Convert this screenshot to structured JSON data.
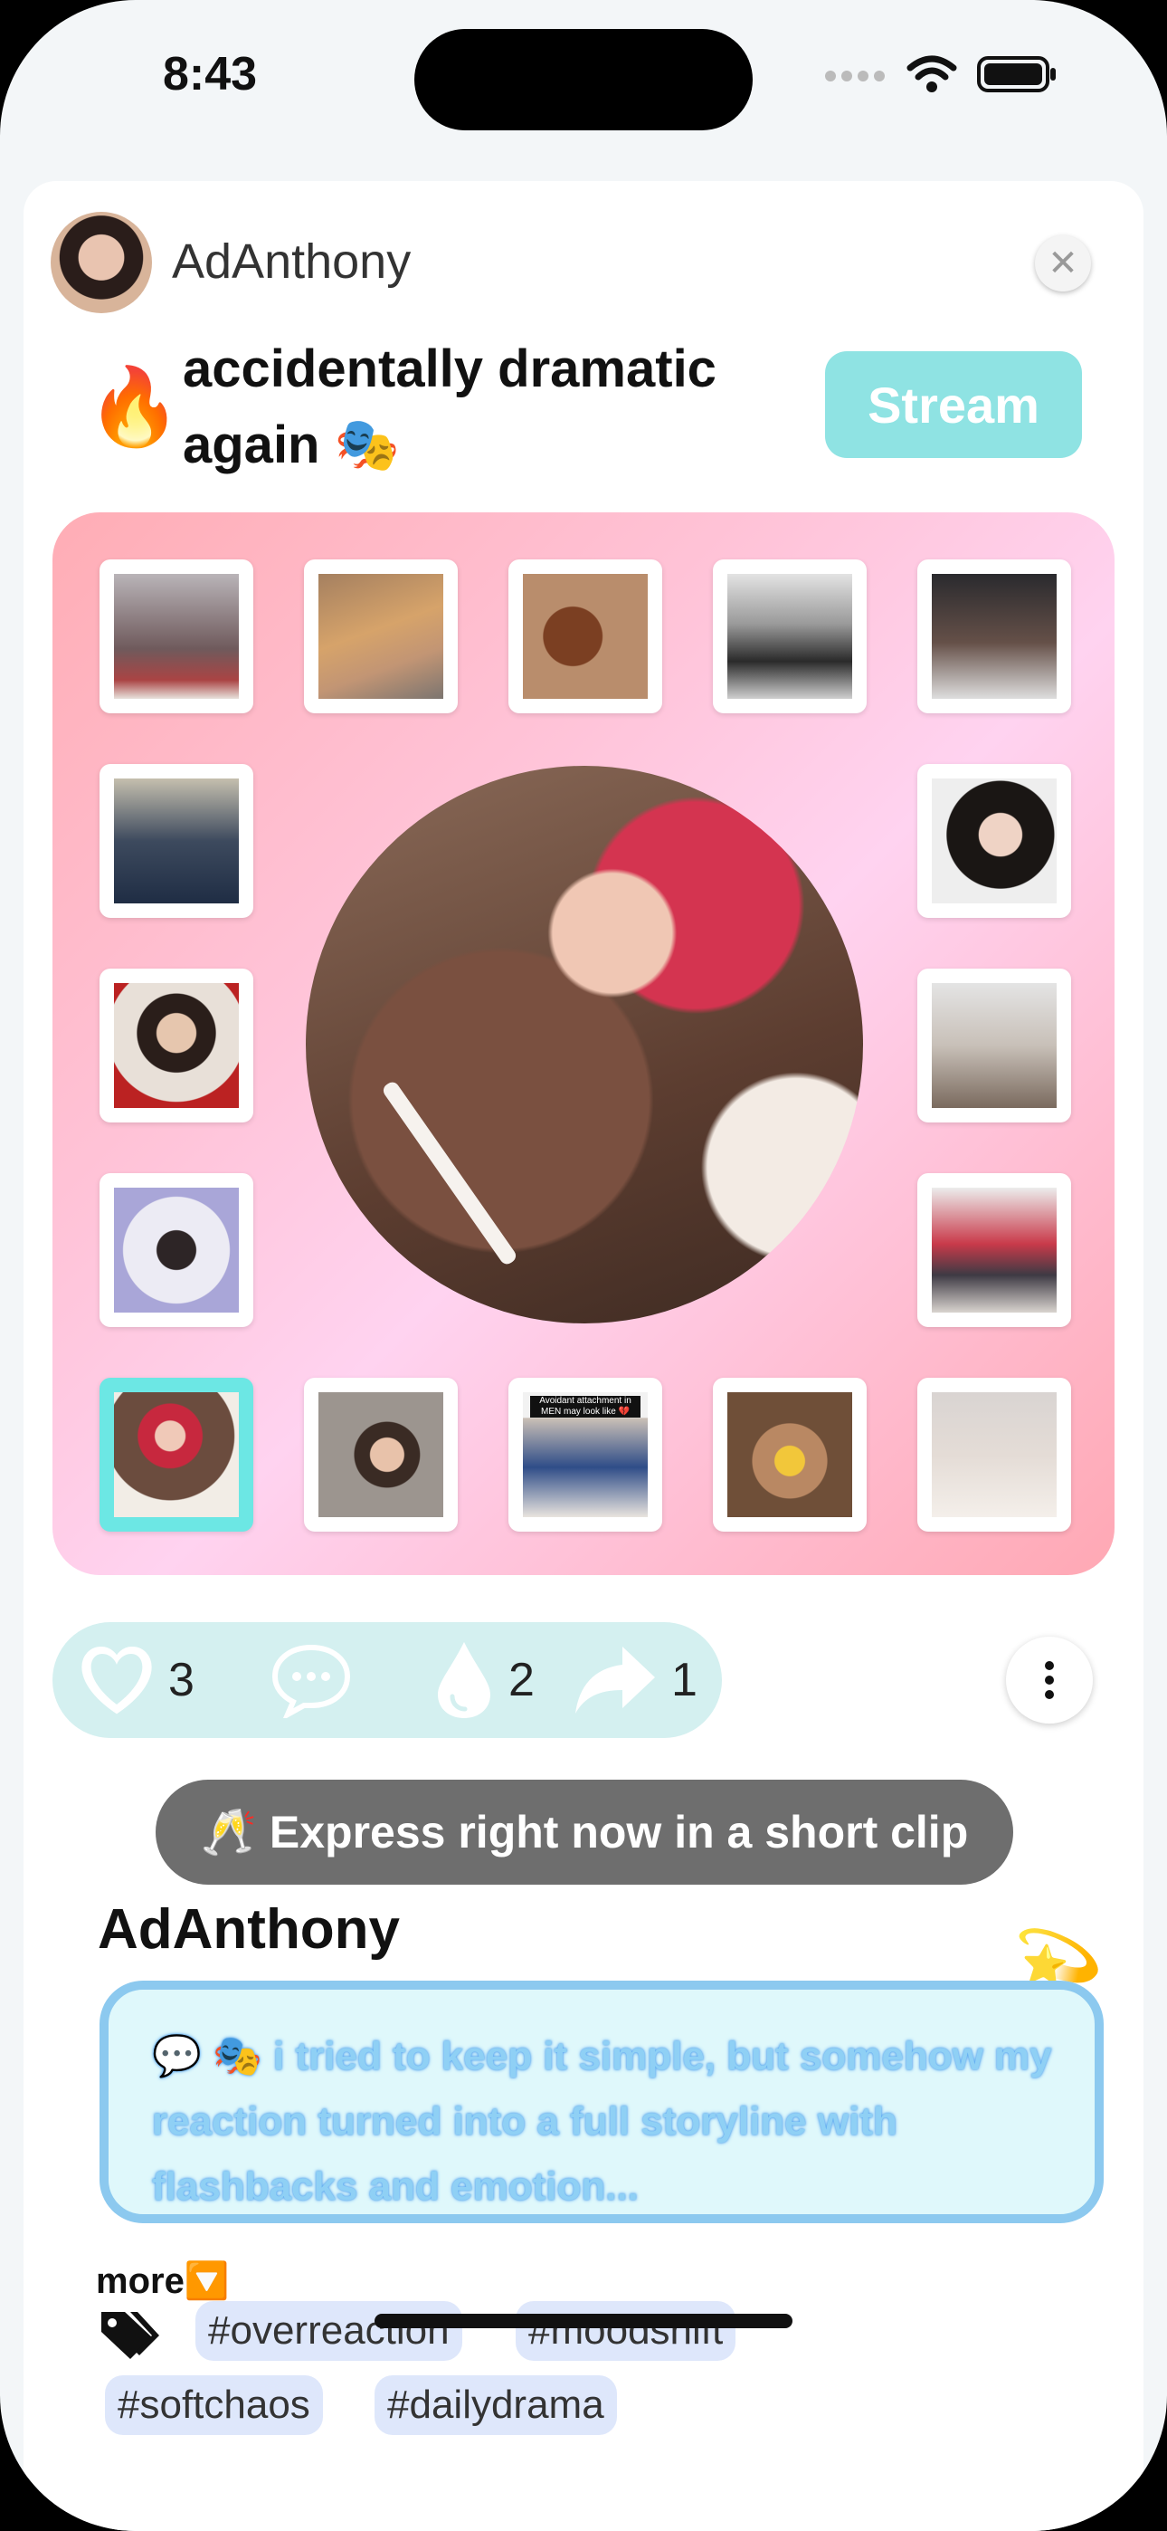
{
  "status_bar": {
    "time": "8:43"
  },
  "post": {
    "top_username": "AdAnthony",
    "mood_emoji": "🔥",
    "mood_text": "accidentally dramatic again 🎭",
    "stream_label": "Stream"
  },
  "actions": {
    "likes": "3",
    "drops": "2",
    "shares": "1"
  },
  "express_label": "🥂 Express right now in a short clip",
  "author": "AdAnthony",
  "caption": "💬 🎭 i tried to keep it simple, but somehow my reaction turned into a full storyline with flashbacks and emotion...",
  "more_label": "more🔽",
  "tags": [
    "#overreaction",
    "#moodshift",
    "#softchaos",
    "#dailydrama"
  ],
  "tile_overlays": {
    "t13": "Avoidant attachment in MEN may look like 💔"
  }
}
